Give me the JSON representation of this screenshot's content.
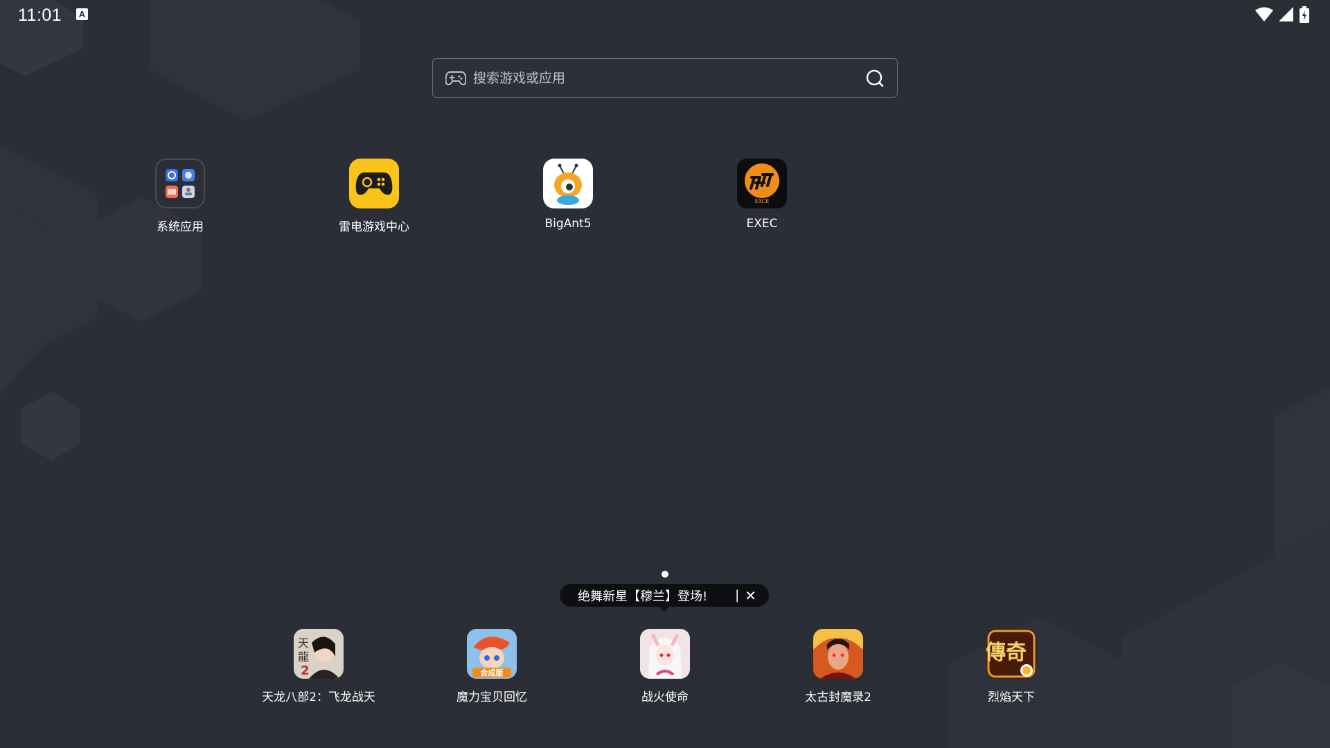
{
  "status_bar": {
    "time": "11:01",
    "notification_icon": "a-badge-icon",
    "wifi_icon": "wifi-icon",
    "signal_icon": "signal-icon",
    "battery_icon": "battery-charging-icon"
  },
  "search": {
    "placeholder": "搜索游戏或应用",
    "left_icon": "gamepad-icon",
    "right_icon": "search-icon"
  },
  "desktop_apps": [
    {
      "label": "系统应用",
      "icon": "folder-icon"
    },
    {
      "label": "雷电游戏中心",
      "icon": "gamepad-icon"
    },
    {
      "label": "BigAnt5",
      "icon": "ant-icon"
    },
    {
      "label": "EXEC",
      "icon": "exec-logo-icon"
    }
  ],
  "exec_icon_caption": "EXCE",
  "banner": {
    "text": "绝舞新星【穆兰】登场!",
    "separator": "|",
    "close": "✕"
  },
  "dock_apps": [
    {
      "label": "天龙八部2：飞龙战天",
      "icon": "game-tianlong-icon",
      "badge": "2"
    },
    {
      "label": "魔力宝贝回忆",
      "icon": "game-moli-icon",
      "badge": "合成版"
    },
    {
      "label": "战火使命",
      "icon": "game-zhanhuo-icon"
    },
    {
      "label": "太古封魔录2",
      "icon": "game-taigu-icon"
    },
    {
      "label": "烈焰天下",
      "icon": "game-lieyan-icon",
      "badge": "傳奇"
    }
  ],
  "colors": {
    "background": "#2b2e36",
    "hexagon": "#33363e",
    "leidian_yellow": "#fcc419",
    "exec_orange": "#f08c1a"
  }
}
